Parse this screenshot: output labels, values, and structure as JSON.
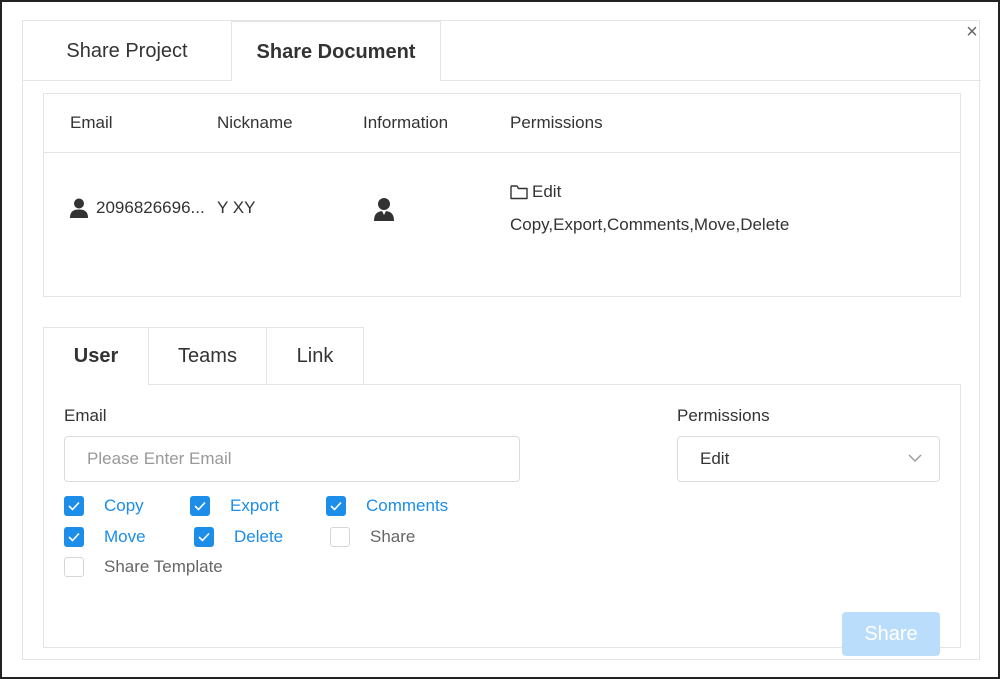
{
  "dialog": {
    "close_label": "×",
    "tabs": [
      {
        "label": "Share Project"
      },
      {
        "label": "Share Document"
      }
    ]
  },
  "table": {
    "headers": [
      "Email",
      "Nickname",
      "Information",
      "Permissions"
    ],
    "row": {
      "email": "2096826696...",
      "nickname": "Y XY",
      "permission_mode": "Edit",
      "permission_list": "Copy,Export,Comments,Move,Delete"
    }
  },
  "sub_tabs": [
    {
      "label": "User"
    },
    {
      "label": "Teams"
    },
    {
      "label": "Link"
    }
  ],
  "form": {
    "email_label": "Email",
    "email_placeholder": "Please Enter Email",
    "email_value": "",
    "permissions_label": "Permissions",
    "permissions_value": "Edit",
    "checkboxes": [
      {
        "label": "Copy",
        "checked": true
      },
      {
        "label": "Export",
        "checked": true
      },
      {
        "label": "Comments",
        "checked": true
      },
      {
        "label": "Move",
        "checked": true
      },
      {
        "label": "Delete",
        "checked": true
      },
      {
        "label": "Share",
        "checked": false
      },
      {
        "label": "Share Template",
        "checked": false
      }
    ],
    "share_button": "Share"
  },
  "colors": {
    "accent": "#1c8de8",
    "button_disabled": "#b9ddfb",
    "border": "#e4e4e4"
  },
  "icons": {
    "close": "close-icon",
    "user": "user-icon",
    "profile": "profile-icon",
    "folder": "folder-icon",
    "chevron": "chevron-down-icon",
    "check": "check-icon"
  }
}
